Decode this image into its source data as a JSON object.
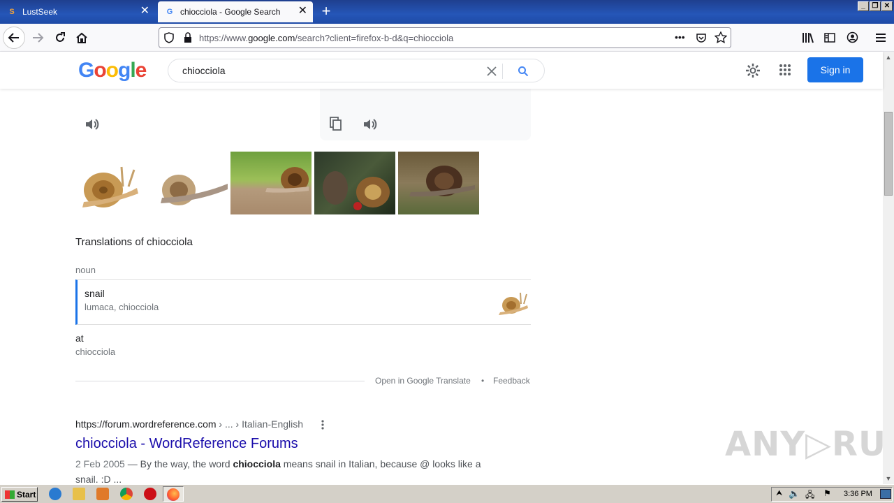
{
  "browser": {
    "tabs": [
      {
        "title": "LustSeek",
        "active": false
      },
      {
        "title": "chiocciola - Google Search",
        "active": true
      }
    ],
    "url_prefix": "https://www.",
    "url_domain": "google.com",
    "url_rest": "/search?client=firefox-b-d&q=chiocciola"
  },
  "google": {
    "logo": [
      "G",
      "o",
      "o",
      "g",
      "l",
      "e"
    ],
    "logo_colors": [
      "#4285f4",
      "#ea4335",
      "#fbbc05",
      "#4285f4",
      "#34a853",
      "#ea4335"
    ],
    "query": "chiocciola",
    "signin_label": "Sign in"
  },
  "translation": {
    "section_title": "Translations of chiocciola",
    "part_of_speech": "noun",
    "rows": [
      {
        "word": "snail",
        "synonyms": "lumaca, chiocciola"
      },
      {
        "word": "at",
        "synonyms": "chiocciola"
      }
    ],
    "open_translate": "Open in Google Translate",
    "bullet": "•",
    "feedback": "Feedback"
  },
  "result": {
    "url": "https://forum.wordreference.com",
    "breadcrumb": " › ... › Italian-English",
    "title": "chiocciola - WordReference Forums",
    "date": "2 Feb 2005",
    "snippet_pre": " — By the way, the word ",
    "snippet_bold": "chiocciola",
    "snippet_post": " means snail in Italian, because @ looks like a snail. :D ..."
  },
  "taskbar": {
    "start_label": "Start",
    "clock": "3:36 PM"
  },
  "watermark": "ANY▷RUN",
  "colors": {
    "accent": "#1a73e8",
    "link": "#1a0dab"
  }
}
